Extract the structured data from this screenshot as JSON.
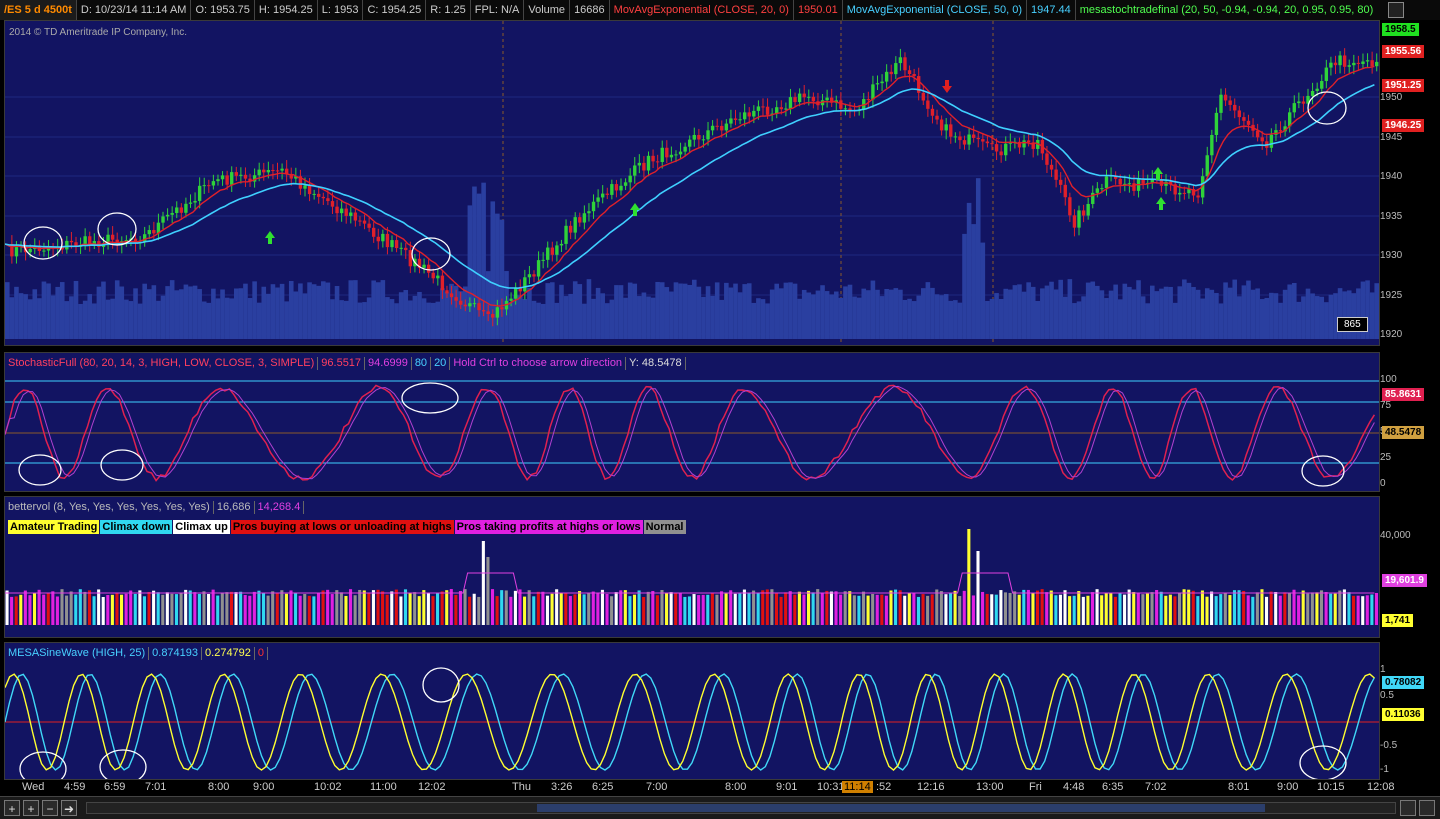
{
  "header": {
    "symbol": "/ES 5 d 4500t",
    "date": "D: 10/23/14 11:14 AM",
    "open": "O: 1953.75",
    "high": "H: 1954.25",
    "low": "L: 1953",
    "close": "C: 1954.25",
    "range": "R: 1.25",
    "fpl": "FPL: N/A",
    "volume_label": "Volume",
    "volume_value": "16686",
    "ma20_label": "MovAvgExponential (CLOSE, 20, 0)",
    "ma20_value": "1950.01",
    "ma50_label": "MovAvgExponential (CLOSE, 50, 0)",
    "ma50_value": "1947.44",
    "study_label": "mesastochtradefinal (20, 50, -0.94, -0.94, 20, 0.95, 0.95, 80)"
  },
  "price_pane": {
    "copyright": "2014 © TD Ameritrade IP Company, Inc.",
    "y_ticks": [
      "1950",
      "1945",
      "1940",
      "1935",
      "1930",
      "1925",
      "1920"
    ],
    "tag_top": "1958.5",
    "tag_ma_high": "1955.56",
    "tag_last": "1951.25",
    "tag_low": "1946.25",
    "volume_badge": "865",
    "colors": {
      "ma20": "#e0202a",
      "ma50": "#3fd0ff",
      "up": "#2fd23a",
      "down": "#e0202a",
      "volume": "#2a3fa0"
    }
  },
  "stoch_pane": {
    "label": "StochasticFull (80, 20, 14, 3, HIGH, LOW, CLOSE, 3, SIMPLE)",
    "k_value": "96.5517",
    "d_value": "94.6999",
    "over_bought": "80",
    "over_sold": "20",
    "hint": "Hold Ctrl to choose arrow direction",
    "y_readout": "Y: 48.5478",
    "y_ticks": [
      "100",
      "75",
      "50",
      "25",
      "0"
    ],
    "tag_k": "85.8631",
    "tag_y": "48.5478"
  },
  "vol_pane": {
    "label": "bettervol (8, Yes, Yes, Yes, Yes, Yes, Yes)",
    "v1": "16,686",
    "v2": "14,268.4",
    "y_ticks": [
      "40,000"
    ],
    "tag_avg": "19,601.9",
    "tag_last": "1,741",
    "legend": [
      {
        "text": "Amateur Trading",
        "bg": "#ffff30",
        "fg": "#000"
      },
      {
        "text": "Climax down",
        "bg": "#30d8f0",
        "fg": "#000"
      },
      {
        "text": "Climax up",
        "bg": "#ffffff",
        "fg": "#000"
      },
      {
        "text": "Pros buying at lows or unloading at highs",
        "bg": "#e01010",
        "fg": "#000"
      },
      {
        "text": "Pros taking profits at highs or lows",
        "bg": "#e020e0",
        "fg": "#000"
      },
      {
        "text": "Normal",
        "bg": "#909090",
        "fg": "#000"
      }
    ]
  },
  "mesa_pane": {
    "label": "MESASineWave (HIGH, 25)",
    "sine_value": "0.874193",
    "lead_value": "0.274792",
    "zero_value": "0",
    "y_ticks": [
      "1",
      "0.5",
      "-0.5",
      "-1"
    ],
    "tag_sine": "0.78082",
    "tag_lead": "0.11036"
  },
  "x_axis": {
    "labels": [
      "Wed",
      "4:59",
      "6:59",
      "7:01",
      "8:00",
      "9:00",
      "10:02",
      "11:00",
      "12:02",
      "Thu",
      "3:26",
      "6:25",
      "7:00",
      "8:00",
      "9:01",
      "10:31",
      "11:14",
      ":52",
      "12:16",
      "13:00",
      "Fri",
      "4:48",
      "6:35",
      "7:02",
      "8:01",
      "9:00",
      "10:15",
      "12:08"
    ],
    "cursor_label": "11:14"
  },
  "toolbar": {
    "crosshair": "+",
    "zoom_in": "+",
    "zoom_out": "−",
    "forward": "➜"
  }
}
